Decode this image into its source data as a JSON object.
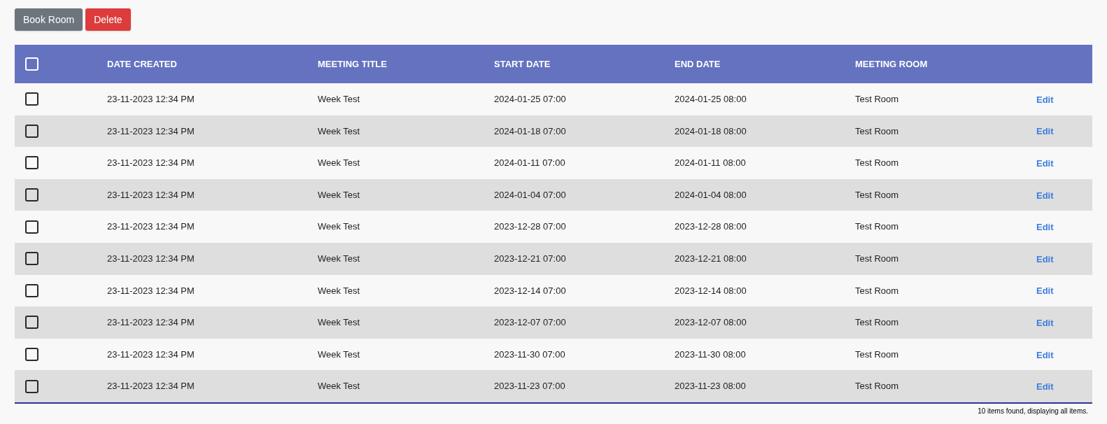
{
  "toolbar": {
    "buttons": [
      {
        "label": "Book Room",
        "kind": "secondary"
      },
      {
        "label": "Delete",
        "kind": "danger"
      }
    ]
  },
  "table": {
    "select_all": {
      "checked": false
    },
    "columns": [
      "DATE CREATED",
      "MEETING TITLE",
      "START DATE",
      "END DATE",
      "MEETING ROOM"
    ],
    "rows": [
      {
        "checked": false,
        "date_created": "23-11-2023 12:34 PM",
        "meeting_title": "Week Test",
        "start_date": "2024-01-25 07:00",
        "end_date": "2024-01-25 08:00",
        "meeting_room": "Test Room",
        "action": "Edit"
      },
      {
        "checked": false,
        "date_created": "23-11-2023 12:34 PM",
        "meeting_title": "Week Test",
        "start_date": "2024-01-18 07:00",
        "end_date": "2024-01-18 08:00",
        "meeting_room": "Test Room",
        "action": "Edit"
      },
      {
        "checked": false,
        "date_created": "23-11-2023 12:34 PM",
        "meeting_title": "Week Test",
        "start_date": "2024-01-11 07:00",
        "end_date": "2024-01-11 08:00",
        "meeting_room": "Test Room",
        "action": "Edit"
      },
      {
        "checked": false,
        "date_created": "23-11-2023 12:34 PM",
        "meeting_title": "Week Test",
        "start_date": "2024-01-04 07:00",
        "end_date": "2024-01-04 08:00",
        "meeting_room": "Test Room",
        "action": "Edit"
      },
      {
        "checked": false,
        "date_created": "23-11-2023 12:34 PM",
        "meeting_title": "Week Test",
        "start_date": "2023-12-28 07:00",
        "end_date": "2023-12-28 08:00",
        "meeting_room": "Test Room",
        "action": "Edit"
      },
      {
        "checked": false,
        "date_created": "23-11-2023 12:34 PM",
        "meeting_title": "Week Test",
        "start_date": "2023-12-21 07:00",
        "end_date": "2023-12-21 08:00",
        "meeting_room": "Test Room",
        "action": "Edit"
      },
      {
        "checked": false,
        "date_created": "23-11-2023 12:34 PM",
        "meeting_title": "Week Test",
        "start_date": "2023-12-14 07:00",
        "end_date": "2023-12-14 08:00",
        "meeting_room": "Test Room",
        "action": "Edit"
      },
      {
        "checked": false,
        "date_created": "23-11-2023 12:34 PM",
        "meeting_title": "Week Test",
        "start_date": "2023-12-07 07:00",
        "end_date": "2023-12-07 08:00",
        "meeting_room": "Test Room",
        "action": "Edit"
      },
      {
        "checked": false,
        "date_created": "23-11-2023 12:34 PM",
        "meeting_title": "Week Test",
        "start_date": "2023-11-30 07:00",
        "end_date": "2023-11-30 08:00",
        "meeting_room": "Test Room",
        "action": "Edit"
      },
      {
        "checked": false,
        "date_created": "23-11-2023 12:34 PM",
        "meeting_title": "Week Test",
        "start_date": "2023-11-23 07:00",
        "end_date": "2023-11-23 08:00",
        "meeting_room": "Test Room",
        "action": "Edit"
      }
    ]
  },
  "footer": {
    "summary": "10 items found, displaying all items."
  }
}
